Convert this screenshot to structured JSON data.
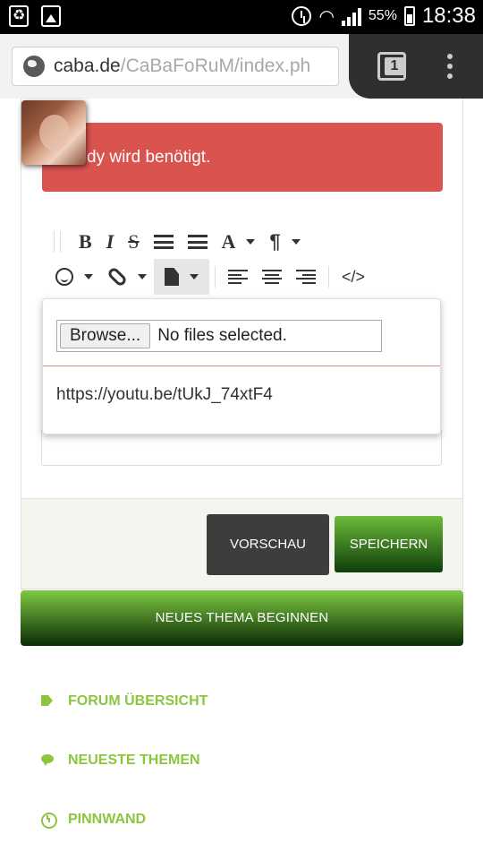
{
  "status_bar": {
    "battery": "55%",
    "time": "18:38",
    "icons": [
      "recycle-icon",
      "image-icon",
      "alarm-icon",
      "wifi-icon",
      "signal-icon",
      "battery-icon"
    ]
  },
  "browser": {
    "url_host": "caba.de",
    "url_path": "/CaBaFoRuM/index.ph",
    "tab_count": "1"
  },
  "alert": {
    "text": "dy wird benötigt."
  },
  "editor": {
    "toolbar_row1": [
      "bold",
      "italic",
      "strikethrough",
      "ordered-list",
      "unordered-list",
      "font",
      "paragraph"
    ],
    "toolbar_row2": [
      "emoticon",
      "link",
      "file",
      "align-left",
      "align-center",
      "align-right",
      "source"
    ],
    "labels": {
      "bold": "B",
      "italic": "I",
      "strike": "S",
      "font": "A",
      "paragraph": "¶",
      "source": "</>"
    }
  },
  "file_popover": {
    "browse_label": "Browse...",
    "file_status": "No files selected.",
    "url_value": "https://youtu.be/tUkJ_74xtF4"
  },
  "actions": {
    "preview": "VORSCHAU",
    "save": "SPEICHERN",
    "new_topic": "NEUES THEMA BEGINNEN"
  },
  "nav_links": [
    {
      "label": "FORUM ÜBERSICHT",
      "icon": "tags-icon"
    },
    {
      "label": "NEUESTE THEMEN",
      "icon": "chat-icon"
    },
    {
      "label": "PINNWAND",
      "icon": "clock-icon"
    }
  ],
  "colors": {
    "alert": "#d9534f",
    "accent_green": "#8cc63f",
    "preview_button": "#3d3d3b"
  }
}
